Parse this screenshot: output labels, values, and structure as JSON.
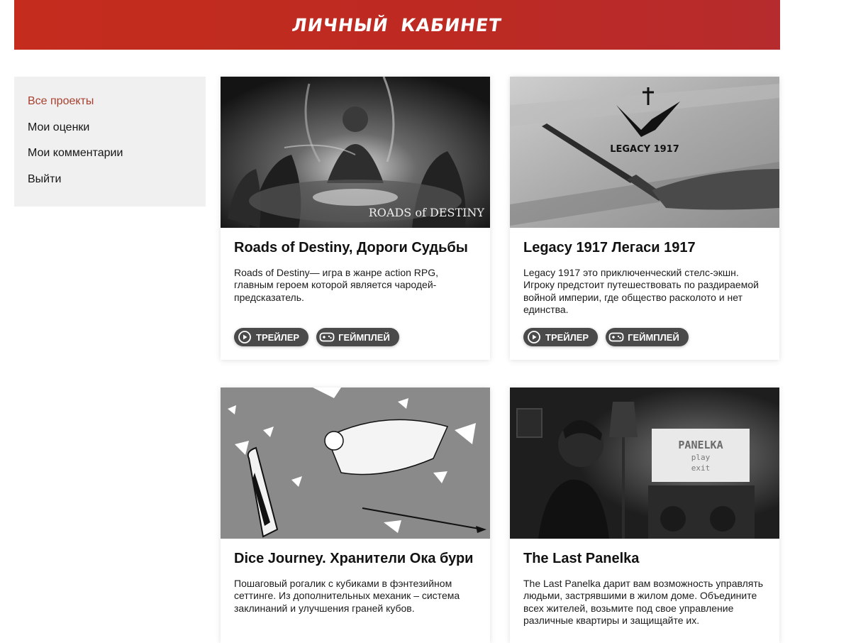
{
  "header": {
    "title": "ЛИЧНЫЙ КАБИНЕТ"
  },
  "sidebar": {
    "items": [
      {
        "label": "Все проекты",
        "active": true
      },
      {
        "label": "Мои оценки",
        "active": false
      },
      {
        "label": "Мои комментарии",
        "active": false
      },
      {
        "label": "Выйти",
        "active": false
      }
    ]
  },
  "cards": [
    {
      "title": "Roads of Destiny, Дороги Судьбы",
      "description": "Roads of Destiny— игра в жанре action RPG, главным героем которой является чародей-предсказатель.",
      "image_logo": "ROADS of DESTINY",
      "trailer_label": "ТРЕЙЛЕР",
      "gameplay_label": "ГЕЙМПЛЕЙ"
    },
    {
      "title": "Legacy 1917 Легаси 1917",
      "description": "Legacy 1917 это приключенческий стелс-экшн. Игроку предстоит путешествовать по раздираемой войной империи, где общество расколото и нет единства.",
      "image_logo": "LEGACY 1917",
      "trailer_label": "ТРЕЙЛЕР",
      "gameplay_label": "ГЕЙМПЛЕЙ"
    },
    {
      "title": "Dice Journey. Хранители Ока бури",
      "description": "Пошаговый рогалик с кубиками в фэнтезийном сеттинге. Из дополнительных механик – система заклинаний и улучшения граней кубов."
    },
    {
      "title": "The Last Panelka",
      "description": "The Last Panelka дарит вам возможность управлять людьми, застрявшими в жилом доме. Объедините всех жителей, возьмите под свое управление различные квартиры и защищайте их.",
      "image_logo": "PANELKA",
      "image_menu_play": "play",
      "image_menu_exit": "exit"
    }
  ],
  "colors": {
    "header_bg": "#c0291f",
    "active_link": "#a8402f",
    "sidebar_bg": "#f0f0f0",
    "button_bg": "#4a4a4a"
  },
  "icons": {
    "trailer": "play-circle-icon",
    "gameplay": "gamepad-icon"
  }
}
